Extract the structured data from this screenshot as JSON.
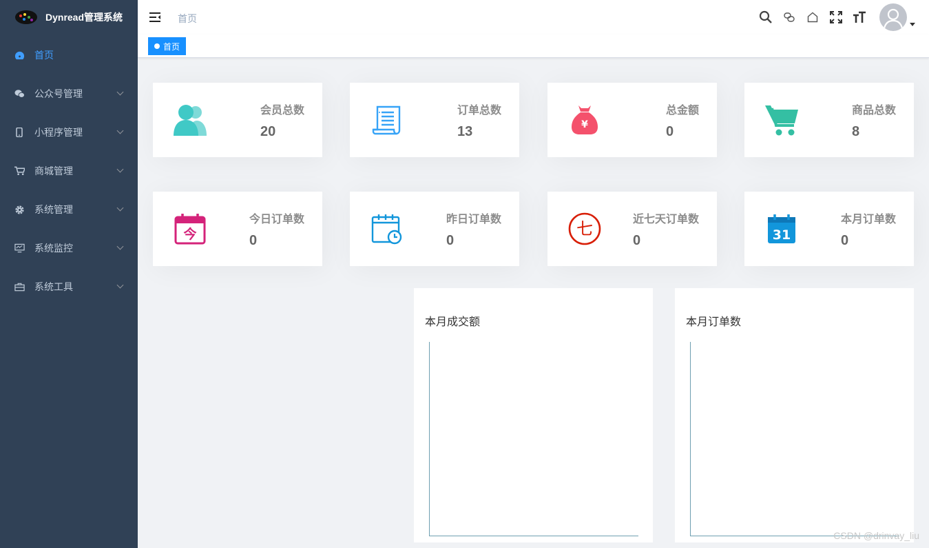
{
  "app": {
    "title": "Dynread管理系统"
  },
  "sidebar": {
    "items": [
      {
        "label": "首页",
        "icon": "dashboard-icon",
        "active": true
      },
      {
        "label": "公众号管理",
        "icon": "wechat-icon",
        "has_children": true
      },
      {
        "label": "小程序管理",
        "icon": "phone-icon",
        "has_children": true
      },
      {
        "label": "商城管理",
        "icon": "cart-icon",
        "has_children": true
      },
      {
        "label": "系统管理",
        "icon": "gear-icon",
        "has_children": true
      },
      {
        "label": "系统监控",
        "icon": "monitor-icon",
        "has_children": true
      },
      {
        "label": "系统工具",
        "icon": "toolbox-icon",
        "has_children": true
      }
    ]
  },
  "header": {
    "breadcrumb": "首页",
    "tools": [
      "search-icon",
      "link-icon",
      "home-icon",
      "fullscreen-icon",
      "font-size-icon"
    ]
  },
  "tags": {
    "active_tag": "首页"
  },
  "stats_row1": [
    {
      "label": "会员总数",
      "value": "20",
      "icon": "members-icon",
      "color": "#40c9c6"
    },
    {
      "label": "订单总数",
      "value": "13",
      "icon": "order-list-icon",
      "color": "#36a3f7"
    },
    {
      "label": "总金额",
      "value": "0",
      "icon": "money-bag-icon",
      "color": "#f4516c"
    },
    {
      "label": "商品总数",
      "value": "8",
      "icon": "shopping-cart-icon",
      "color": "#34bfa3"
    }
  ],
  "stats_row2": [
    {
      "label": "今日订单数",
      "value": "0",
      "icon": "today-calendar-icon",
      "color": "#d4237a",
      "glyph": "今"
    },
    {
      "label": "昨日订单数",
      "value": "0",
      "icon": "yesterday-calendar-icon",
      "color": "#1296db"
    },
    {
      "label": "近七天订单数",
      "value": "0",
      "icon": "seven-days-icon",
      "color": "#d81e06",
      "glyph": "七"
    },
    {
      "label": "本月订单数",
      "value": "0",
      "icon": "month-calendar-icon",
      "color": "#1296db",
      "glyph": "31"
    }
  ],
  "charts": [
    {
      "title": "本月成交额"
    },
    {
      "title": "本月订单数"
    }
  ],
  "watermark": "CSDN @drinvay_liu"
}
